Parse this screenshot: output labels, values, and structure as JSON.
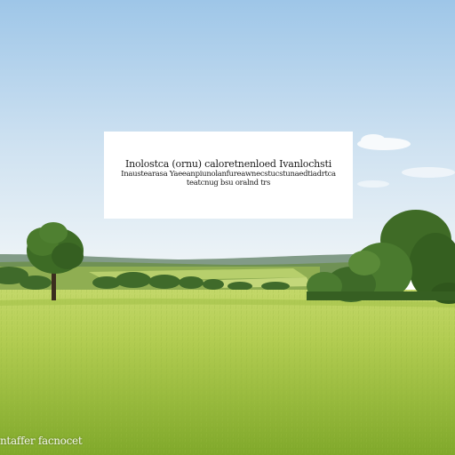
{
  "caption": {
    "line1": "Inolostca (ornu) caloretnenloed  Ivanlochsti",
    "line2": "Inaustearasa Yaeeanpiunolanfureawnecstucstunaedtiadrtca",
    "line3": "teatcnug bsu oralnd trs"
  },
  "watermark": {
    "text": "‎ntaffer facnocet"
  },
  "colors": {
    "sky_top": "#a9cdea",
    "sky_bottom": "#e8f1f7",
    "field_far": "#b8cf5a",
    "field_near": "#86ad2e",
    "tree": "#3d6b25"
  }
}
